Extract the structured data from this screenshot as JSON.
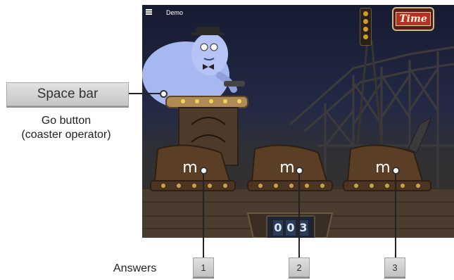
{
  "header": {
    "menu_icon": "hamburger-menu-icon",
    "demo_label": "Demo",
    "time_label": "Time"
  },
  "operator_key": {
    "label": "Space bar",
    "caption_line1": "Go button",
    "caption_line2": "(coaster operator)"
  },
  "carts": [
    {
      "letter": "m"
    },
    {
      "letter": "m"
    },
    {
      "letter": "m"
    }
  ],
  "counter": {
    "digits": [
      "0",
      "0",
      "3"
    ]
  },
  "answers": {
    "label": "Answers",
    "keys": [
      "1",
      "2",
      "3"
    ]
  },
  "colors": {
    "sky": "#161b31",
    "ghost": "#a7b7ef",
    "cart_wood": "#5a3f26",
    "time_sign": "#b43124"
  }
}
